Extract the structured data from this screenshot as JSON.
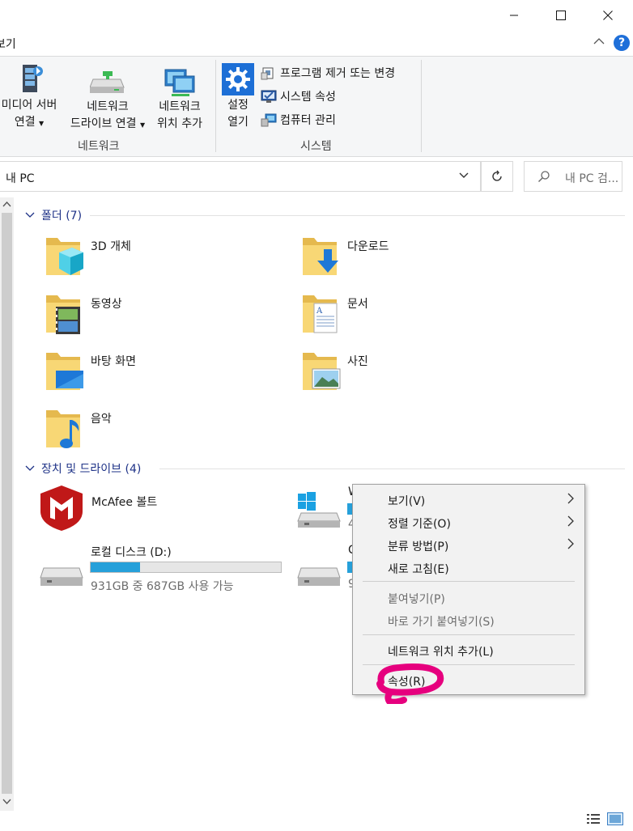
{
  "window": {
    "controls": [
      "minimize",
      "maximize",
      "close"
    ]
  },
  "tabs": {
    "partial_tab": "보기",
    "help_label": "?"
  },
  "ribbon": {
    "media_server": {
      "line1": "미디어 서버",
      "line2": "연결"
    },
    "map_drive": {
      "line1": "네트워크",
      "line2": "드라이브 연결"
    },
    "add_location": {
      "line1": "네트워크",
      "line2": "위치 추가"
    },
    "network_group": "네트워크",
    "open_settings": {
      "line1": "설정",
      "line2": "열기"
    },
    "uninstall": "프로그램 제거 또는 변경",
    "system_props": "시스템 속성",
    "manage": "컴퓨터 관리",
    "system_group": "시스템"
  },
  "address": {
    "path": "내 PC",
    "search_placeholder": "내 PC 검..."
  },
  "folders_section": {
    "title": "폴더 (7)",
    "items": [
      {
        "name": "3D 개체",
        "icon": "3d-objects-folder-icon"
      },
      {
        "name": "다운로드",
        "icon": "downloads-folder-icon"
      },
      {
        "name": "동영상",
        "icon": "videos-folder-icon"
      },
      {
        "name": "문서",
        "icon": "documents-folder-icon"
      },
      {
        "name": "바탕 화면",
        "icon": "desktop-folder-icon"
      },
      {
        "name": "사진",
        "icon": "pictures-folder-icon"
      },
      {
        "name": "음악",
        "icon": "music-folder-icon"
      }
    ]
  },
  "devices_section": {
    "title": "장치 및 드라이브 (4)",
    "mcafee": "McAfee 볼트",
    "drive_d": {
      "name": "로컬 디스크 (D:)",
      "usage_text": "931GB 중 687GB 사용 가능",
      "used_fraction": 0.26
    },
    "drive_c": {
      "name_partial": "W",
      "sub_partial": "4"
    },
    "drive_other": {
      "name_partial": "C",
      "sub_partial": "9"
    }
  },
  "context_menu": {
    "items": [
      {
        "label": "보기(V)",
        "submenu": true,
        "disabled": false
      },
      {
        "label": "정렬 기준(O)",
        "submenu": true,
        "disabled": false
      },
      {
        "label": "분류 방법(P)",
        "submenu": true,
        "disabled": false
      },
      {
        "label": "새로 고침(E)",
        "submenu": false,
        "disabled": false
      },
      {
        "label": "붙여넣기(P)",
        "submenu": false,
        "disabled": true
      },
      {
        "label": "바로 가기 붙여넣기(S)",
        "submenu": false,
        "disabled": true
      },
      {
        "label": "네트워크 위치 추가(L)",
        "submenu": false,
        "disabled": false
      },
      {
        "label": "속성(R)",
        "submenu": false,
        "disabled": false
      }
    ],
    "highlight_color": "#e6007e"
  },
  "colors": {
    "accent": "#26a0da",
    "section_header": "#1e3287",
    "folder_yellow": "#f8d775"
  }
}
